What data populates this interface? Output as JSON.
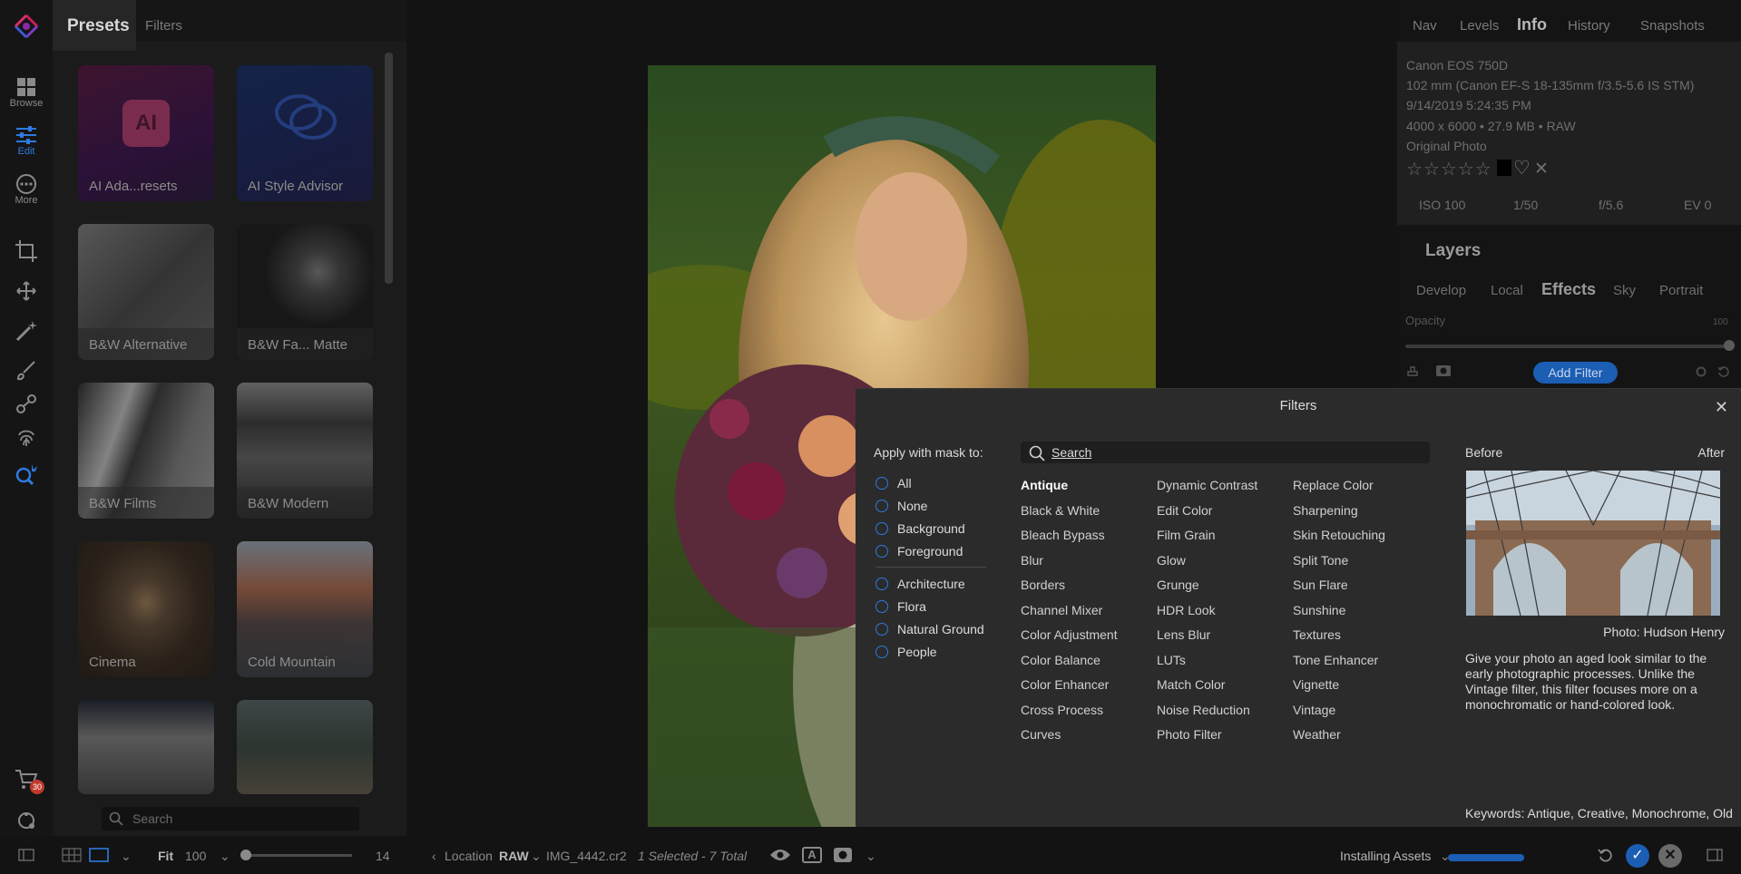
{
  "left_toolbar": {
    "browse_label": "Browse",
    "edit_label": "Edit",
    "more_label": "More",
    "cart_badge": "30"
  },
  "presets_panel": {
    "tab_presets": "Presets",
    "tab_filters": "Filters",
    "cards": [
      "AI Ada...resets",
      "AI Style Advisor",
      "B&W Alternative",
      "B&W Fa... Matte",
      "B&W Films",
      "B&W Modern",
      "Cinema",
      "Cold Mountain"
    ],
    "ai_badge": "AI",
    "search_placeholder": "Search"
  },
  "right_panel": {
    "tabs": [
      "Nav",
      "Levels",
      "Info",
      "History",
      "Snapshots"
    ],
    "active_tab": "Info",
    "info": {
      "camera": "Canon EOS 750D",
      "lens": "102 mm (Canon EF-S 18-135mm f/3.5-5.6 IS STM)",
      "datetime": "9/14/2019 5:24:35 PM",
      "dims": "4000 x 6000 • 27.9 MB • RAW",
      "kind": "Original Photo",
      "iso": "ISO 100",
      "shutter": "1/50",
      "aperture": "f/5.6",
      "ev": "EV 0"
    },
    "layers_title": "Layers",
    "layer_tabs": [
      "Develop",
      "Local",
      "Effects",
      "Sky",
      "Portrait"
    ],
    "active_layer_tab": "Effects",
    "opacity_label": "Opacity",
    "opacity_value": "100",
    "add_filter_label": "Add Filter"
  },
  "filters_dialog": {
    "title": "Filters",
    "close_glyph": "✕",
    "mask_title": "Apply with mask to:",
    "mask_options": [
      "All",
      "None",
      "Background",
      "Foreground"
    ],
    "subject_options": [
      "Architecture",
      "Flora",
      "Natural Ground",
      "People"
    ],
    "search_placeholder": "Search",
    "selected_filter": "Antique",
    "col1": [
      "Antique",
      "Black & White",
      "Bleach Bypass",
      "Blur",
      "Borders",
      "Channel Mixer",
      "Color Adjustment",
      "Color Balance",
      "Color Enhancer",
      "Cross Process",
      "Curves"
    ],
    "col2": [
      "Dynamic Contrast",
      "Edit Color",
      "Film Grain",
      "Glow",
      "Grunge",
      "HDR Look",
      "Lens Blur",
      "LUTs",
      "Match Color",
      "Noise Reduction",
      "Photo Filter"
    ],
    "col3": [
      "Replace Color",
      "Sharpening",
      "Skin Retouching",
      "Split Tone",
      "Sun Flare",
      "Sunshine",
      "Textures",
      "Tone Enhancer",
      "Vignette",
      "Vintage",
      "Weather"
    ],
    "before_label": "Before",
    "after_label": "After",
    "photo_credit": "Photo: Hudson Henry",
    "description": "Give your photo an aged look similar to the early photographic processes. Unlike the Vintage filter, this filter focuses more on a monochromatic or hand-colored look.",
    "keywords": "Keywords: Antique, Creative, Monochrome, Old"
  },
  "bottom_bar": {
    "fit_label": "Fit",
    "zoom_value": "100",
    "slider_value": "14",
    "location_label": "Location",
    "format_label": "RAW",
    "filename": "IMG_4442.cr2",
    "selection_status": "1 Selected - 7 Total",
    "installing_label": "Installing Assets"
  },
  "colors": {
    "accent": "#2d7ae0",
    "button_blue": "#1b5eb4",
    "dialog_bg": "#2b2b2b",
    "cart_badge": "#c0392b"
  }
}
